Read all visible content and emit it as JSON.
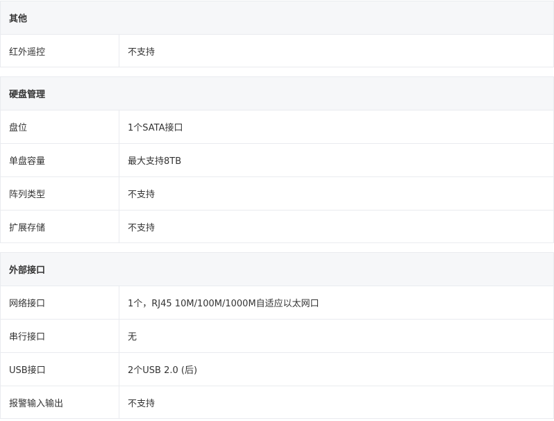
{
  "sections": [
    {
      "title": "其他",
      "rows": [
        {
          "label": "红外遥控",
          "value": "不支持"
        }
      ]
    },
    {
      "title": "硬盘管理",
      "rows": [
        {
          "label": "盘位",
          "value": "1个SATA接口"
        },
        {
          "label": "单盘容量",
          "value": "最大支持8TB"
        },
        {
          "label": "阵列类型",
          "value": "不支持"
        },
        {
          "label": "扩展存储",
          "value": "不支持"
        }
      ]
    },
    {
      "title": "外部接口",
      "rows": [
        {
          "label": "网络接口",
          "value": "1个，RJ45 10M/100M/1000M自适应以太网口"
        },
        {
          "label": "串行接口",
          "value": "无"
        },
        {
          "label": "USB接口",
          "value": "2个USB 2.0 (后)"
        },
        {
          "label": "报警输入输出",
          "value": "不支持"
        }
      ]
    }
  ]
}
